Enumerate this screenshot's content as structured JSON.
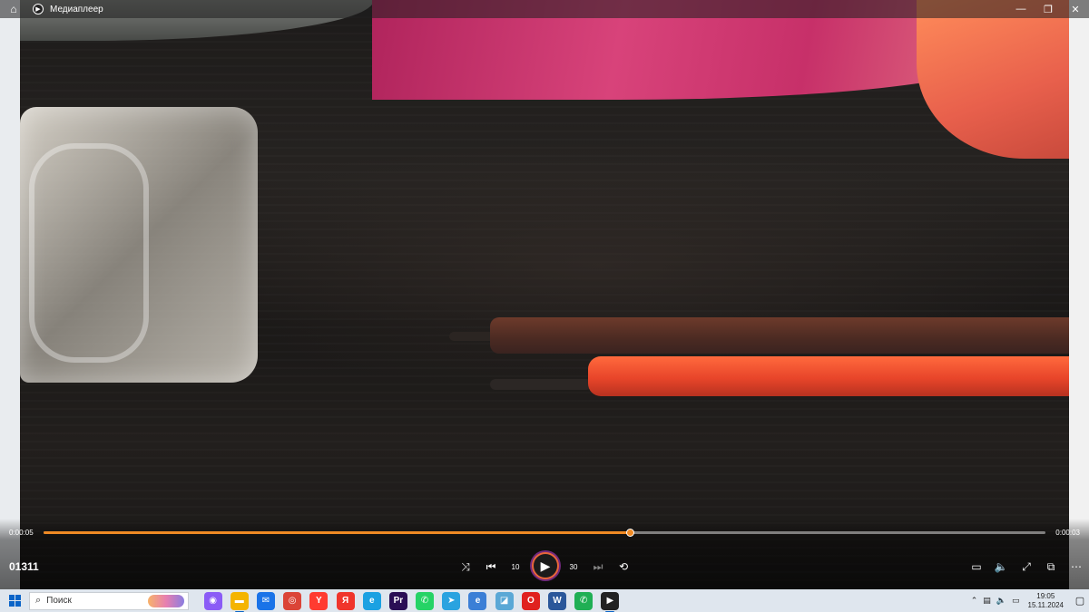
{
  "window": {
    "title": "Медиаплеер",
    "home_icon": "home-icon",
    "controls": [
      "minimize-icon",
      "restore-icon",
      "close-icon"
    ]
  },
  "player": {
    "media_title": "01311",
    "time_current": "0:00:05",
    "time_remaining": "0:00:03",
    "progress_fraction": 0.585,
    "accent_color": "#f08a24",
    "rewind_label": "10",
    "forward_label": "30"
  },
  "taskbar": {
    "search_placeholder": "Поиск",
    "pinned_apps": [
      {
        "name": "alice-app",
        "glyph": "◉",
        "bg": "#8b5cf6"
      },
      {
        "name": "file-explorer",
        "glyph": "▬",
        "bg": "#f4b400"
      },
      {
        "name": "mail-app",
        "glyph": "✉",
        "bg": "#1a73e8"
      },
      {
        "name": "chrome",
        "glyph": "◎",
        "bg": "#db4437"
      },
      {
        "name": "yandex-browser",
        "glyph": "Y",
        "bg": "#ff3b30"
      },
      {
        "name": "yandex-app",
        "glyph": "Я",
        "bg": "#f0352c"
      },
      {
        "name": "edge-app",
        "glyph": "e",
        "bg": "#1ba1e2"
      },
      {
        "name": "premiere-pro",
        "glyph": "Pr",
        "bg": "#2a0f55"
      },
      {
        "name": "whatsapp",
        "glyph": "✆",
        "bg": "#25d366"
      },
      {
        "name": "telegram",
        "glyph": "➤",
        "bg": "#2aa3e0"
      },
      {
        "name": "edge-browser",
        "glyph": "e",
        "bg": "#3b7fd6"
      },
      {
        "name": "app-notes",
        "glyph": "◪",
        "bg": "#5aa8d6"
      },
      {
        "name": "opera",
        "glyph": "O",
        "bg": "#e0211f"
      },
      {
        "name": "word-app",
        "glyph": "W",
        "bg": "#2b579a"
      },
      {
        "name": "whatsapp-alt",
        "glyph": "✆",
        "bg": "#1faf54"
      },
      {
        "name": "media-player",
        "glyph": "▶",
        "bg": "#222222"
      }
    ],
    "time": "19:05",
    "date": "15.11.2024"
  }
}
